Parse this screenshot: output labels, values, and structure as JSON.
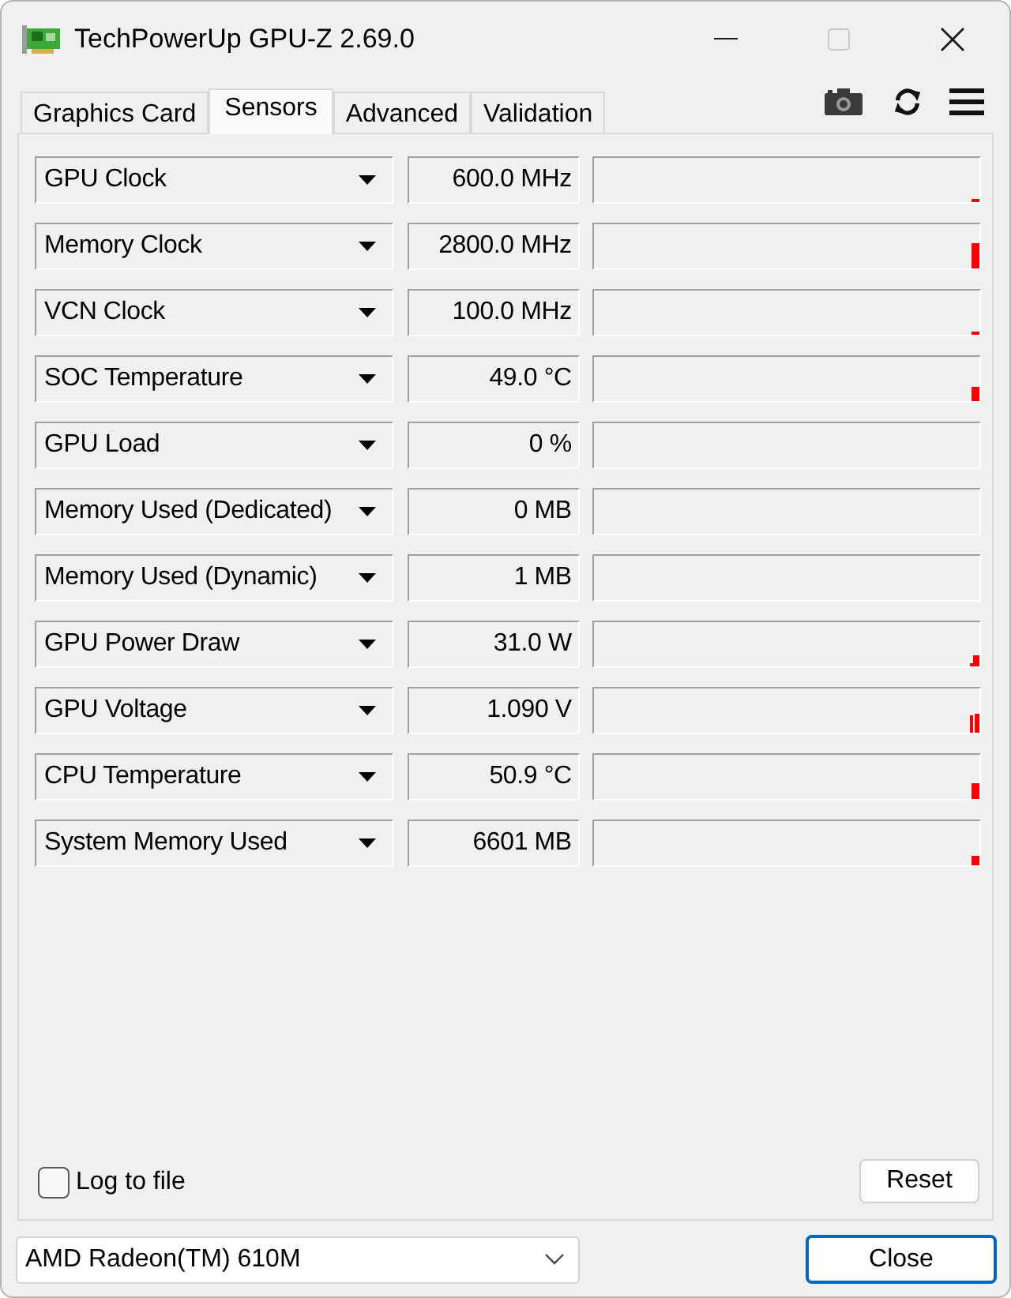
{
  "window": {
    "title": "TechPowerUp GPU-Z 2.69.0",
    "maximize_disabled": true
  },
  "tabs": [
    {
      "label": "Graphics Card",
      "selected": false
    },
    {
      "label": "Sensors",
      "selected": true
    },
    {
      "label": "Advanced",
      "selected": false
    },
    {
      "label": "Validation",
      "selected": false
    }
  ],
  "sensors": [
    {
      "name": "GPU Clock",
      "reading": "600.0 MHz"
    },
    {
      "name": "Memory Clock",
      "reading": "2800.0 MHz"
    },
    {
      "name": "VCN Clock",
      "reading": "100.0 MHz"
    },
    {
      "name": "SOC Temperature",
      "reading": "49.0 °C"
    },
    {
      "name": "GPU Load",
      "reading": "0 %"
    },
    {
      "name": "Memory Used (Dedicated)",
      "reading": "0 MB"
    },
    {
      "name": "Memory Used (Dynamic)",
      "reading": "1 MB"
    },
    {
      "name": "GPU Power Draw",
      "reading": "31.0 W"
    },
    {
      "name": "GPU Voltage",
      "reading": "1.090 V"
    },
    {
      "name": "CPU Temperature",
      "reading": "50.9 °C"
    },
    {
      "name": "System Memory Used",
      "reading": "6601 MB"
    }
  ],
  "log_to_file": {
    "label": "Log to file",
    "checked": false
  },
  "reset_button": "Reset",
  "gpu_select": {
    "value": "AMD Radeon(TM) 610M"
  },
  "close_button": "Close"
}
